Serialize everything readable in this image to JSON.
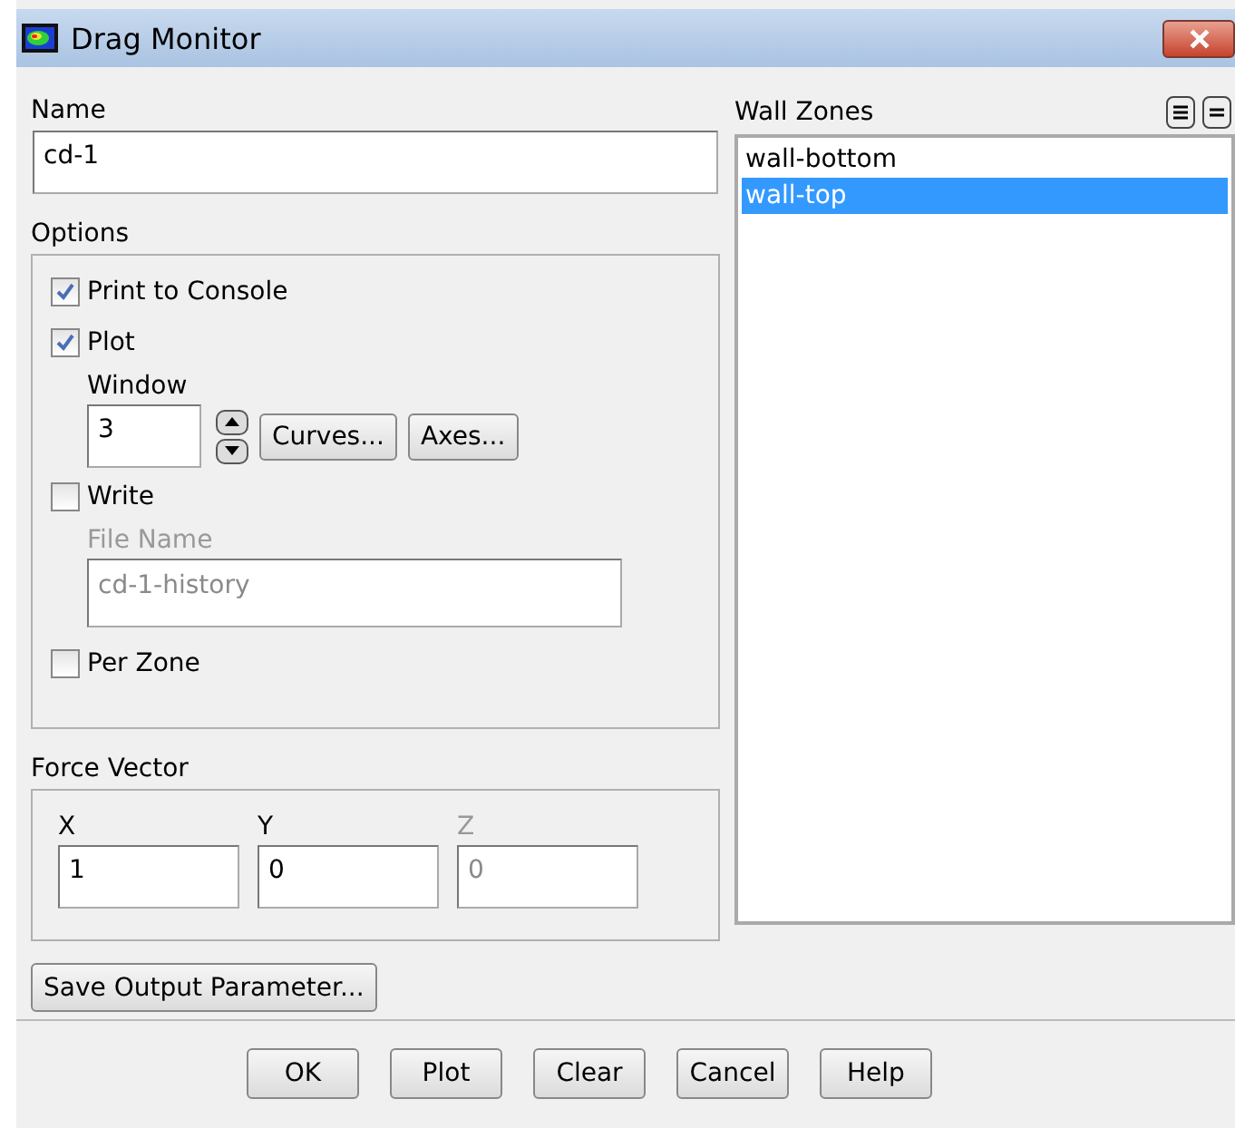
{
  "window": {
    "title": "Drag Monitor"
  },
  "name": {
    "label": "Name",
    "value": "cd-1"
  },
  "options": {
    "label": "Options",
    "print_to_console": {
      "label": "Print to Console",
      "checked": true
    },
    "plot": {
      "label": "Plot",
      "checked": true
    },
    "window_field": {
      "label": "Window",
      "value": "3"
    },
    "curves_button": "Curves...",
    "axes_button": "Axes...",
    "write": {
      "label": "Write",
      "checked": false
    },
    "file_name": {
      "label": "File Name",
      "value": "cd-1-history",
      "disabled": true
    },
    "per_zone": {
      "label": "Per Zone",
      "checked": false
    }
  },
  "force_vector": {
    "label": "Force Vector",
    "components": [
      {
        "label": "X",
        "value": "1",
        "disabled": false
      },
      {
        "label": "Y",
        "value": "0",
        "disabled": false
      },
      {
        "label": "Z",
        "value": "0",
        "disabled": true
      }
    ]
  },
  "save_button": "Save Output Parameter...",
  "wall_zones": {
    "label": "Wall Zones",
    "items": [
      {
        "label": "wall-bottom",
        "selected": false
      },
      {
        "label": "wall-top",
        "selected": true
      }
    ]
  },
  "buttons": [
    "OK",
    "Plot",
    "Clear",
    "Cancel",
    "Help"
  ]
}
